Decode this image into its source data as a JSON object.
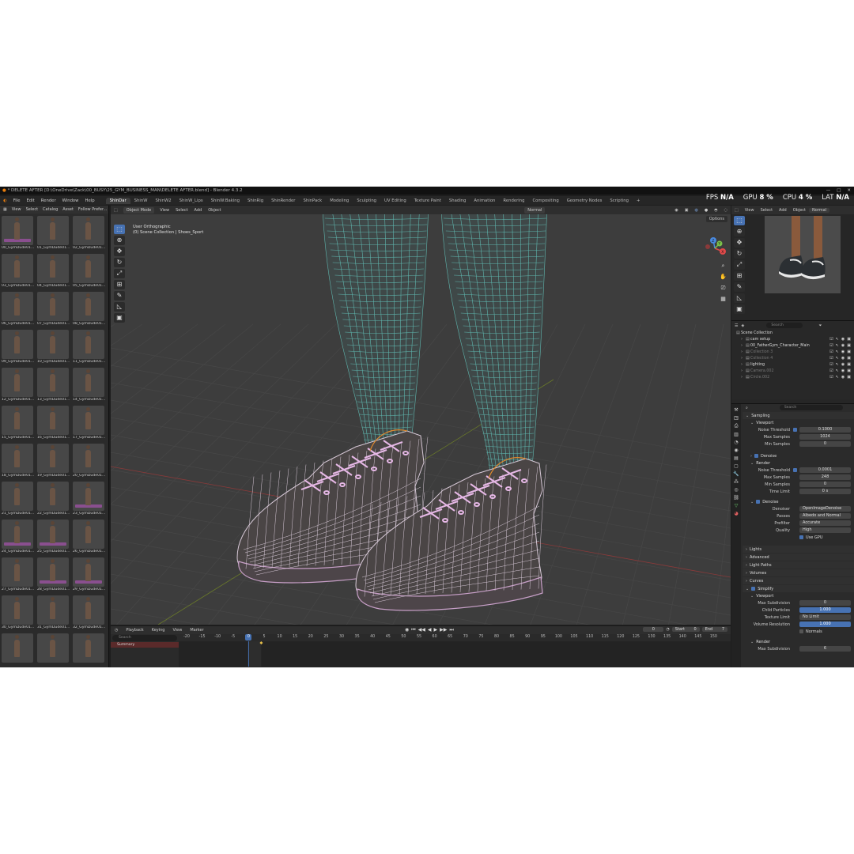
{
  "window": {
    "title": "* DELETE AFTER [D:\\OneDrive\\Zack\\00_BUSY\\25_GYM_BUSINESS_MAN\\DELETE AFTER.blend] - Blender 4.3.2",
    "minimize": "—",
    "maximize": "□",
    "close": "✕"
  },
  "perf": {
    "fps_label": "FPS",
    "fps_value": "N/A",
    "gpu_label": "GPU",
    "gpu_value": "8 %",
    "cpu_label": "CPU",
    "cpu_value": "4 %",
    "lat_label": "LAT",
    "lat_value": "N/A"
  },
  "menu": [
    "File",
    "Edit",
    "Render",
    "Window",
    "Help"
  ],
  "tabs": [
    "ShinDar",
    "ShinW",
    "ShinW2",
    "ShinW_Lips",
    "ShinW:Baking",
    "ShinRig",
    "ShinRender",
    "ShinPack",
    "Modeling",
    "Sculpting",
    "UV Editing",
    "Texture Paint",
    "Shading",
    "Animation",
    "Rendering",
    "Compositing",
    "Geometry Nodes",
    "Scripting",
    "+"
  ],
  "active_tab": "ShinDar",
  "asset_browser": {
    "menu": [
      "View",
      "Select",
      "Catalog",
      "Asset",
      "Follow Prefer..."
    ],
    "items": [
      {
        "label": "00_GymDude01...",
        "mat": true
      },
      {
        "label": "01_GymDude01...",
        "mat": false
      },
      {
        "label": "02_GymDude01...",
        "mat": false
      },
      {
        "label": "03_GymDude01...",
        "mat": false
      },
      {
        "label": "04_GymDude01...",
        "mat": false
      },
      {
        "label": "05_GymDude01...",
        "mat": false
      },
      {
        "label": "06_GymDude01...",
        "mat": false
      },
      {
        "label": "07_GymDude01...",
        "mat": false
      },
      {
        "label": "08_GymDude01...",
        "mat": false
      },
      {
        "label": "09_GymDude01...",
        "mat": false
      },
      {
        "label": "10_GymDude01...",
        "mat": false
      },
      {
        "label": "11_GymDude01...",
        "mat": false
      },
      {
        "label": "12_GymDude01...",
        "mat": false
      },
      {
        "label": "13_GymDude01...",
        "mat": false
      },
      {
        "label": "14_GymDude01...",
        "mat": false
      },
      {
        "label": "15_GymDude01...",
        "mat": false
      },
      {
        "label": "16_GymDude01...",
        "mat": false
      },
      {
        "label": "17_GymDude01...",
        "mat": false
      },
      {
        "label": "18_GymDude01...",
        "mat": false
      },
      {
        "label": "19_GymDude01...",
        "mat": false
      },
      {
        "label": "20_GymDude01...",
        "mat": false
      },
      {
        "label": "21_GymDude01...",
        "mat": false
      },
      {
        "label": "22_GymDude01...",
        "mat": false
      },
      {
        "label": "23_GymDude01...",
        "mat": true
      },
      {
        "label": "24_GymDude01...",
        "mat": true
      },
      {
        "label": "25_GymDude01...",
        "mat": true
      },
      {
        "label": "26_GymDude01...",
        "mat": false
      },
      {
        "label": "27_GymDude01...",
        "mat": false
      },
      {
        "label": "28_GymDude01...",
        "mat": true
      },
      {
        "label": "29_GymDude01...",
        "mat": true
      },
      {
        "label": "30_GymDude01...",
        "mat": false
      },
      {
        "label": "31_GymDude01...",
        "mat": false
      },
      {
        "label": "32_GymDude01...",
        "mat": false
      },
      {
        "label": "",
        "mat": false
      },
      {
        "label": "",
        "mat": false
      },
      {
        "label": "",
        "mat": false
      }
    ]
  },
  "viewport": {
    "mode": "Object Mode",
    "menu": [
      "View",
      "Select",
      "Add",
      "Object"
    ],
    "orientation": "Normal",
    "options": "Options",
    "view_name": "User Orthographic",
    "collection_path": "(0) Scene Collection | Shoes_Sport",
    "gizmo": {
      "x": "X",
      "y": "Y",
      "z": "Z"
    }
  },
  "timeline": {
    "menu": [
      "Playback",
      "Keying",
      "View",
      "Marker"
    ],
    "search_placeholder": "Search",
    "summary": "Summary",
    "current_frame": "0",
    "start_label": "Start",
    "start": "0",
    "end_label": "End",
    "end": "7",
    "frame_field": "0",
    "ticks": [
      "-20",
      "-15",
      "-10",
      "-5",
      "0",
      "5",
      "10",
      "15",
      "20",
      "25",
      "30",
      "35",
      "40",
      "45",
      "50",
      "55",
      "60",
      "65",
      "70",
      "75",
      "80",
      "85",
      "90",
      "95",
      "100",
      "105",
      "110",
      "115",
      "120",
      "125",
      "130",
      "135",
      "140",
      "145",
      "150"
    ]
  },
  "right_view": {
    "menu": [
      "View",
      "Select",
      "Add",
      "Object"
    ],
    "orientation": "Normal"
  },
  "outliner": {
    "search_placeholder": "Search",
    "root": "Scene Collection",
    "rows": [
      {
        "name": "cam setup",
        "dim": false
      },
      {
        "name": "00_FatherGym_Character_Main",
        "dim": false
      },
      {
        "name": "Collection 3",
        "dim": true
      },
      {
        "name": "Collection 4",
        "dim": true
      },
      {
        "name": "lighting",
        "dim": false
      },
      {
        "name": "Camera.002",
        "dim": true
      },
      {
        "name": "Circle.002",
        "dim": true
      }
    ]
  },
  "properties": {
    "search_placeholder": "Search",
    "sampling": "Sampling",
    "viewport": "Viewport",
    "noise_threshold_label": "Noise Threshold",
    "vp_noise_threshold": "0.1000",
    "max_samples_label": "Max Samples",
    "vp_max_samples": "1024",
    "min_samples_label": "Min Samples",
    "vp_min_samples": "0",
    "denoise": "Denoise",
    "render": "Render",
    "r_noise_threshold": "0.0001",
    "r_max_samples": "248",
    "r_min_samples": "0",
    "time_limit_label": "Time Limit",
    "r_time_limit": "0 s",
    "denoise2": "Denoise",
    "denoiser_label": "Denoiser",
    "denoiser": "OpenImageDenoise",
    "passes_label": "Passes",
    "passes": "Albedo and Normal",
    "prefilter_label": "Prefilter",
    "prefilter": "Accurate",
    "quality_label": "Quality",
    "quality": "High",
    "use_gpu": "Use GPU",
    "lights": "Lights",
    "advanced": "Advanced",
    "light_paths": "Light Paths",
    "volumes": "Volumes",
    "curves": "Curves",
    "simplify": "Simplify",
    "simplify_viewport": "Viewport",
    "max_subdivision_label": "Max Subdivision",
    "s_max_subdivision": "0",
    "child_particles_label": "Child Particles",
    "s_child_particles": "1.000",
    "texture_limit_label": "Texture Limit",
    "s_texture_limit": "No Limit",
    "volume_resolution_label": "Volume Resolution",
    "s_volume_resolution": "1.000",
    "normals": "Normals",
    "simplify_render": "Render",
    "r_max_subdivision_label": "Max Subdivision",
    "r_max_subdivision": "6"
  },
  "colors": {
    "accent": "#4772b3",
    "leg_wire": "#5fb5ad",
    "shoe_wire": "#d7c9d7",
    "selected_outline": "#e08a2e"
  }
}
